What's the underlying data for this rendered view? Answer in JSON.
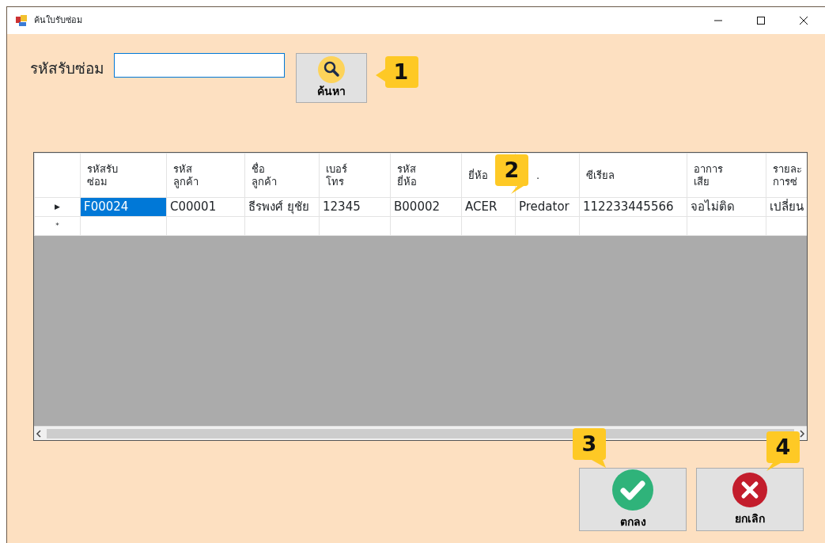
{
  "window": {
    "title": "ค้นใบรับซ่อม"
  },
  "search": {
    "label": "รหัสรับซ่อม",
    "button": "ค้นหา"
  },
  "grid": {
    "columns": [
      "รหัสรับ\nซ่อม",
      "รหัส\nลูกค้า",
      "ชื่อ\nลูกค้า",
      "เบอร์\nโทร",
      "รหัส\nยี่ห้อ",
      "ยี่ห้อ",
      ".",
      "ซีเรียล",
      "อาการ\nเสีย",
      "รายละ\nการซ่"
    ],
    "rows": [
      {
        "marker": "▶",
        "cells": [
          {
            "text": "F00024",
            "selected": true
          },
          {
            "text": "C00001",
            "selected": false
          },
          {
            "text": "ธีรพงศ์ ยุชัย",
            "selected": false
          },
          {
            "text": "12345",
            "selected": false
          },
          {
            "text": "B00002",
            "selected": false
          },
          {
            "text": "ACER",
            "selected": false
          },
          {
            "text": "Predator",
            "selected": false
          },
          {
            "text": "112233445566",
            "selected": false
          },
          {
            "text": "จอไม่ติด",
            "selected": false
          },
          {
            "text": "เปลี่ยน",
            "selected": false
          }
        ]
      }
    ],
    "new_row_marker": "*"
  },
  "buttons": [
    {
      "label": "ตกลง",
      "kind": "ok"
    },
    {
      "label": "ยกเลิก",
      "kind": "cancel"
    }
  ],
  "callouts": [
    "1",
    "2",
    "3",
    "4"
  ]
}
